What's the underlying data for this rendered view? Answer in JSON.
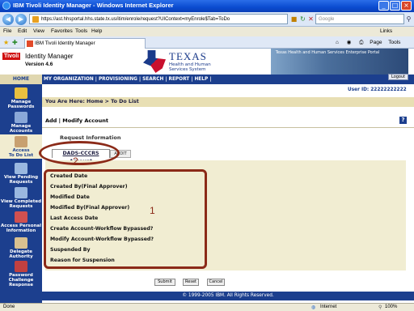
{
  "browser": {
    "title": "IBM Tivoli Identity Manager - Windows Internet Explorer",
    "url": "https://ast.hhsportal.hhs.state.tx.us/itim/enrole/request?UIContext=myEnrole$Tab=ToDo",
    "search_placeholder": "Google",
    "menu": [
      "File",
      "Edit",
      "View",
      "Favorites",
      "Tools",
      "Help"
    ],
    "links_label": "Links",
    "tab_title": "IBM Tivoli Identity Manager",
    "page_menu": "Page",
    "tools_menu": "Tools",
    "status_text": "Done",
    "zone": "Internet",
    "zoom": "100%"
  },
  "header": {
    "logo": "Tivoli",
    "app_name": "Identity Manager",
    "version": "Version 4.6",
    "texas": "TEXAS",
    "hhs_line1": "Health and Human",
    "hhs_line2": "Services System",
    "portal_text": "Texas Health and Human Services Enterprise Portal",
    "logout": "Logout"
  },
  "nav": {
    "home": "HOME",
    "items": [
      "MY ORGANIZATION",
      "PROVISIONING",
      "SEARCH",
      "REPORT",
      "HELP"
    ]
  },
  "sidebar": {
    "items": [
      {
        "label1": "Manage",
        "label2": "Passwords",
        "icon": "key-icon"
      },
      {
        "label1": "Manage",
        "label2": "Accounts",
        "icon": "accounts-icon"
      },
      {
        "label1": "Access",
        "label2": "To Do List",
        "icon": "todo-icon"
      },
      {
        "label1": "View Pending",
        "label2": "Requests",
        "icon": "pending-icon"
      },
      {
        "label1": "View Completed",
        "label2": "Requests",
        "icon": "completed-icon"
      },
      {
        "label1": "Access Personal",
        "label2": "Information",
        "icon": "person-icon"
      },
      {
        "label1": "Delegate",
        "label2": "Authority",
        "icon": "delegate-icon"
      },
      {
        "label1": "Password Challenge",
        "label2": "Response",
        "icon": "challenge-icon"
      }
    ]
  },
  "user_id": "User ID: 22222222222",
  "breadcrumb": "You Are Here: Home > To Do List",
  "page_title": "Add | Modify Account",
  "section_title": "Request Information",
  "tabs": {
    "active": "DADS-CCCRS Account",
    "inactive": "AUDIT"
  },
  "fields": [
    "Created Date",
    "Created By(Final Approver)",
    "Modified Date",
    "Modified By(Final Approver)",
    "Last Access Date",
    "Create Account-Workflow Bypassed?",
    "Modify Account-Workflow Bypassed?",
    "Suspended By",
    "Reason for Suspension"
  ],
  "buttons": {
    "submit": "Submit",
    "reset": "Reset",
    "cancel": "Cancel"
  },
  "footer": "© 1999-2005 IBM. All Rights Reserved.",
  "annotations": {
    "label1": "1",
    "label2": "2",
    "color": "#8b2a18"
  }
}
